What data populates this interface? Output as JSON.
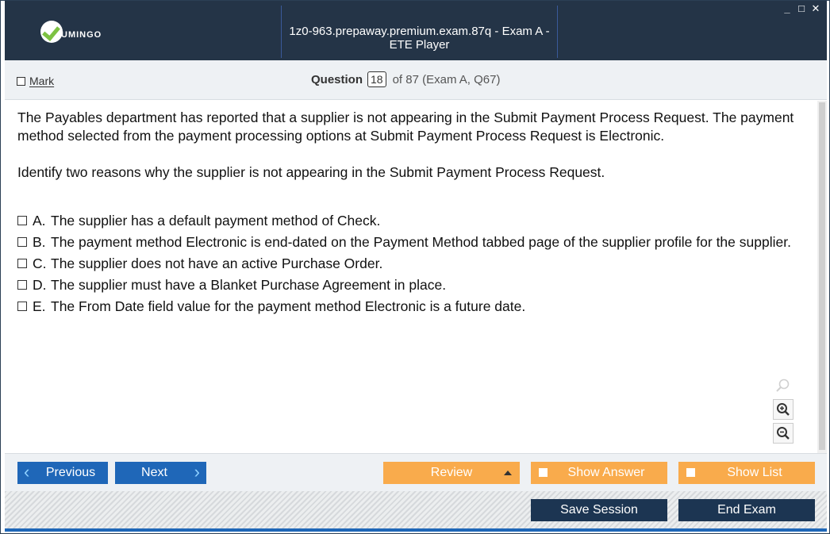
{
  "window": {
    "logo_text": "UMINGO",
    "title": "1z0-963.prepaway.premium.exam.87q - Exam A - ETE Player",
    "controls": [
      "_",
      "□",
      "✕"
    ]
  },
  "header": {
    "mark_label": "Mark",
    "question_label": "Question",
    "question_number": "18",
    "question_of": "of 87 (Exam A, Q67)"
  },
  "question": {
    "paragraphs": [
      "The Payables department has reported that a supplier is not appearing in the Submit Payment Process Request. The payment method selected from the payment processing options at Submit Payment Process Request is Electronic.",
      "Identify two reasons why the supplier is not appearing in the Submit Payment Process Request."
    ],
    "options": [
      {
        "letter": "A.",
        "text": "The supplier has a default payment method of Check."
      },
      {
        "letter": "B.",
        "text": "The payment method Electronic is end-dated on the Payment Method tabbed page of the supplier profile for the supplier."
      },
      {
        "letter": "C.",
        "text": "The supplier does not have an active Purchase Order."
      },
      {
        "letter": "D.",
        "text": "The supplier must have a Blanket Purchase Agreement in place."
      },
      {
        "letter": "E.",
        "text": "The From Date field value for the payment method Electronic is a future date."
      }
    ]
  },
  "navigation": {
    "previous_label": "Previous",
    "next_label": "Next",
    "review_label": "Review",
    "show_answer_label": "Show Answer",
    "show_list_label": "Show List",
    "save_session_label": "Save Session",
    "end_exam_label": "End Exam"
  },
  "colors": {
    "titlebar": "#243447",
    "nav_button_blue": "#1f67b8",
    "nav_button_orange": "#f9ab4c",
    "dark_button": "#1c3552",
    "logo_check": "#7dc242"
  },
  "icons": [
    "check-logo-icon",
    "minimize-icon",
    "maximize-icon",
    "close-icon",
    "search-icon",
    "zoom-in-icon",
    "zoom-out-icon",
    "chevron-left-icon",
    "chevron-right-icon",
    "triangle-up-icon"
  ]
}
